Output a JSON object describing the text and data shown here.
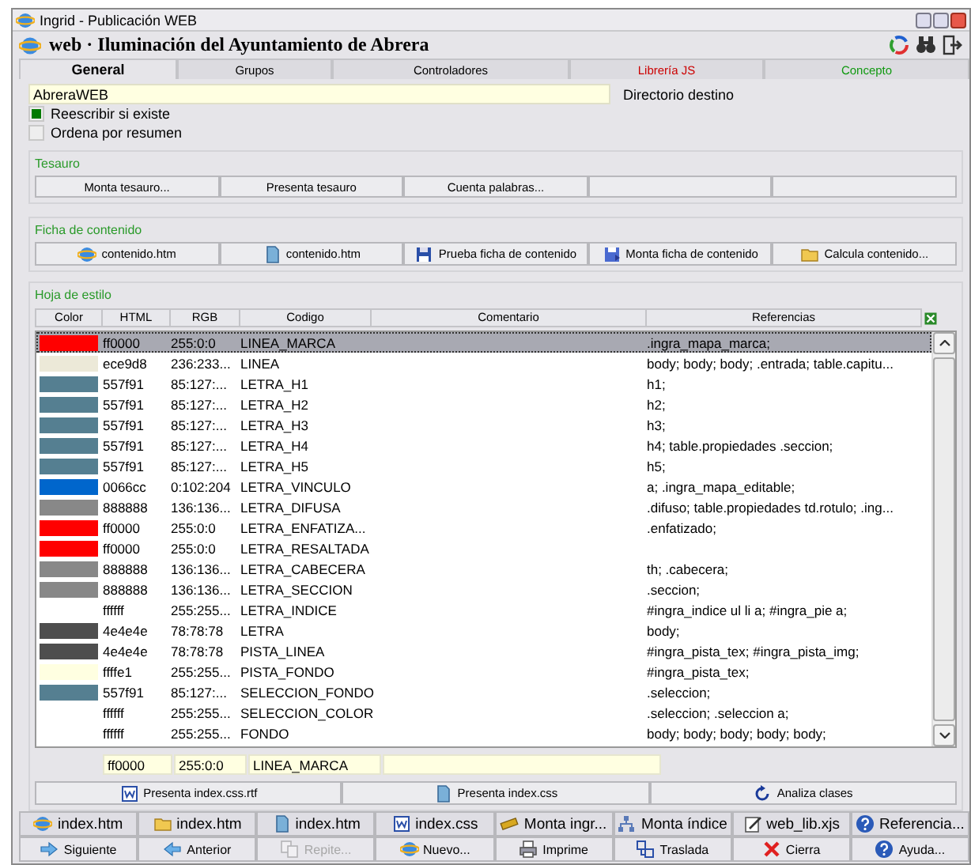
{
  "window": {
    "title": "Ingrid - Publicación WEB"
  },
  "header": {
    "title": "web · Iluminación del Ayuntamiento de Abrera"
  },
  "tabs": [
    {
      "label": "General",
      "selected": true,
      "color": "#000000"
    },
    {
      "label": "Grupos",
      "selected": false,
      "color": "#000000"
    },
    {
      "label": "Controladores",
      "selected": false,
      "color": "#000000"
    },
    {
      "label": "Librería JS",
      "selected": false,
      "color": "#cc0000"
    },
    {
      "label": "Concepto",
      "selected": false,
      "color": "#119911"
    }
  ],
  "destination": {
    "value": "AbreraWEB",
    "label": "Directorio destino"
  },
  "options": [
    {
      "label": "Reescribir si existe",
      "checked": true
    },
    {
      "label": "Ordena por resumen",
      "checked": false
    }
  ],
  "tesauro": {
    "title": "Tesauro",
    "buttons": [
      {
        "kind": "text",
        "label": "Monta tesauro..."
      },
      {
        "kind": "text",
        "label": "Presenta tesauro"
      },
      {
        "kind": "text",
        "label": "Cuenta palabras..."
      },
      {
        "kind": "blank"
      },
      {
        "kind": "blank"
      }
    ]
  },
  "ficha": {
    "title": "Ficha de contenido",
    "buttons": [
      {
        "label": "contenido.htm"
      },
      {
        "label": "contenido.htm"
      },
      {
        "label": "Prueba ficha de contenido"
      },
      {
        "label": "Monta ficha de contenido"
      },
      {
        "label": "Calcula contenido..."
      }
    ]
  },
  "stylesheet": {
    "title": "Hoja de estilo",
    "columns": [
      "Color",
      "HTML",
      "RGB",
      "Codigo",
      "Comentario",
      "Referencias"
    ],
    "rows": [
      {
        "color": "#ff0000",
        "html": "ff0000",
        "rgb": "255:0:0",
        "codigo": "LINEA_MARCA",
        "referencias": ".ingra_mapa_marca;",
        "selected": true
      },
      {
        "color": "#ece9d8",
        "html": "ece9d8",
        "rgb": "236:233...",
        "codigo": "LINEA",
        "referencias": "body; body; body; .entrada; table.capitu...",
        "selected": false
      },
      {
        "color": "#557f91",
        "html": "557f91",
        "rgb": "85:127:...",
        "codigo": "LETRA_H1",
        "referencias": "h1;",
        "selected": false
      },
      {
        "color": "#557f91",
        "html": "557f91",
        "rgb": "85:127:...",
        "codigo": "LETRA_H2",
        "referencias": "h2;",
        "selected": false
      },
      {
        "color": "#557f91",
        "html": "557f91",
        "rgb": "85:127:...",
        "codigo": "LETRA_H3",
        "referencias": "h3;",
        "selected": false
      },
      {
        "color": "#557f91",
        "html": "557f91",
        "rgb": "85:127:...",
        "codigo": "LETRA_H4",
        "referencias": "h4; table.propiedades .seccion;",
        "selected": false
      },
      {
        "color": "#557f91",
        "html": "557f91",
        "rgb": "85:127:...",
        "codigo": "LETRA_H5",
        "referencias": "h5;",
        "selected": false
      },
      {
        "color": "#0066cc",
        "html": "0066cc",
        "rgb": "0:102:204",
        "codigo": "LETRA_VINCULO",
        "referencias": "a; .ingra_mapa_editable;",
        "selected": false
      },
      {
        "color": "#888888",
        "html": "888888",
        "rgb": "136:136...",
        "codigo": "LETRA_DIFUSA",
        "referencias": ".difuso; table.propiedades td.rotulo; .ing...",
        "selected": false
      },
      {
        "color": "#ff0000",
        "html": "ff0000",
        "rgb": "255:0:0",
        "codigo": "LETRA_ENFATIZA...",
        "referencias": ".enfatizado;",
        "selected": false
      },
      {
        "color": "#ff0000",
        "html": "ff0000",
        "rgb": "255:0:0",
        "codigo": "LETRA_RESALTADA",
        "selected": false
      },
      {
        "color": "#888888",
        "html": "888888",
        "rgb": "136:136...",
        "codigo": "LETRA_CABECERA",
        "referencias": "th; .cabecera;",
        "selected": false
      },
      {
        "color": "#888888",
        "html": "888888",
        "rgb": "136:136...",
        "codigo": "LETRA_SECCION",
        "referencias": ".seccion;",
        "selected": false
      },
      {
        "color": "#ffffff",
        "html": "ffffff",
        "rgb": "255:255...",
        "codigo": "LETRA_INDICE",
        "referencias": "#ingra_indice ul li a; #ingra_pie a;",
        "selected": false
      },
      {
        "color": "#4e4e4e",
        "html": "4e4e4e",
        "rgb": "78:78:78",
        "codigo": "LETRA",
        "referencias": "body;",
        "selected": false
      },
      {
        "color": "#4e4e4e",
        "html": "4e4e4e",
        "rgb": "78:78:78",
        "codigo": "PISTA_LINEA",
        "referencias": "#ingra_pista_tex; #ingra_pista_img;",
        "selected": false
      },
      {
        "color": "#ffffe1",
        "html": "ffffe1",
        "rgb": "255:255...",
        "codigo": "PISTA_FONDO",
        "referencias": "#ingra_pista_tex;",
        "selected": false
      },
      {
        "color": "#557f91",
        "html": "557f91",
        "rgb": "85:127:...",
        "codigo": "SELECCION_FONDO",
        "referencias": ".seleccion;",
        "selected": false
      },
      {
        "color": "#ffffff",
        "html": "ffffff",
        "rgb": "255:255...",
        "codigo": "SELECCION_COLOR",
        "referencias": ".seleccion; .seleccion a;",
        "selected": false
      },
      {
        "color": "#ffffff",
        "html": "ffffff",
        "rgb": "255:255...",
        "codigo": "FONDO",
        "referencias": "body; body; body; body; body;",
        "selected": false
      }
    ],
    "editor": {
      "html": "ff0000",
      "rgb": "255:0:0",
      "codigo": "LINEA_MARCA"
    },
    "buttons": [
      {
        "label": "Presenta index.css.rtf"
      },
      {
        "label": "Presenta index.css"
      },
      {
        "label": "Analiza clases"
      }
    ]
  },
  "toolbar": [
    {
      "label": "index.htm"
    },
    {
      "label": "index.htm"
    },
    {
      "label": "index.htm"
    },
    {
      "label": "index.css"
    },
    {
      "label": "Monta ingr..."
    },
    {
      "label": "Monta índice"
    },
    {
      "label": "web_lib.xjs"
    },
    {
      "label": "Referencia..."
    }
  ],
  "actions": [
    {
      "label": "Siguiente",
      "disabled": false
    },
    {
      "label": "Anterior",
      "disabled": false
    },
    {
      "label": "Repite...",
      "disabled": true
    },
    {
      "label": "Nuevo...",
      "disabled": false
    },
    {
      "label": "Imprime",
      "disabled": false
    },
    {
      "label": "Traslada",
      "disabled": false
    },
    {
      "label": "Cierra",
      "disabled": false
    },
    {
      "label": "Ayuda...",
      "disabled": false
    }
  ]
}
